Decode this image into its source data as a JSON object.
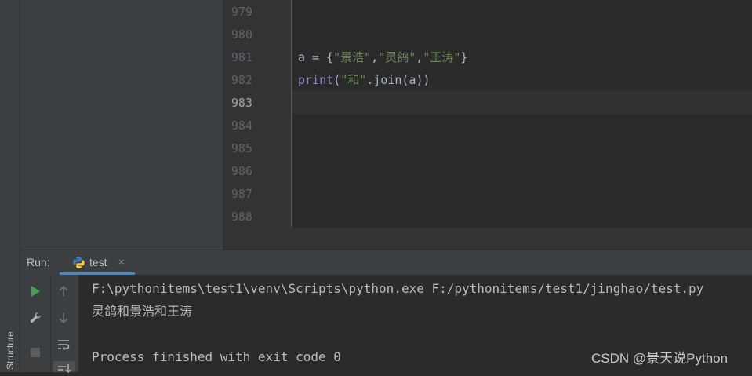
{
  "sidebar": {
    "structure_tab_label": "Structure"
  },
  "editor": {
    "line_numbers": [
      "979",
      "980",
      "981",
      "982",
      "983",
      "984",
      "985",
      "986",
      "987",
      "988"
    ],
    "current_line": "983",
    "code": {
      "line981": {
        "var": "a",
        "op": " = {",
        "s1": "\"景浩\"",
        "c1": ",",
        "s2": "\"灵鸽\"",
        "c2": ",",
        "s3": "\"王涛\"",
        "close": "}"
      },
      "line982": {
        "func": "print",
        "open": "(",
        "s1": "\"和\"",
        "rest": ".join(a))"
      }
    }
  },
  "run_panel": {
    "label": "Run:",
    "tab": {
      "label": "test",
      "close": "×",
      "icon": "python-icon"
    },
    "toolbar_icons": [
      "rerun-icon",
      "up-arrow-icon",
      "wrench-icon",
      "down-arrow-icon",
      "stop-icon",
      "soft-wrap-icon",
      "scroll-to-end-icon"
    ],
    "console_lines": [
      "F:\\pythonitems\\test1\\venv\\Scripts\\python.exe F:/pythonitems/test1/jinghao/test.py",
      "灵鸽和景浩和王涛",
      "",
      "Process finished with exit code 0"
    ]
  },
  "watermark": "CSDN @景天说Python",
  "colors": {
    "string": "#6a8759",
    "builtin": "#8888c6",
    "text": "#a9b7c6",
    "run_green": "#499c54",
    "tab_underline": "#4a88c7"
  }
}
